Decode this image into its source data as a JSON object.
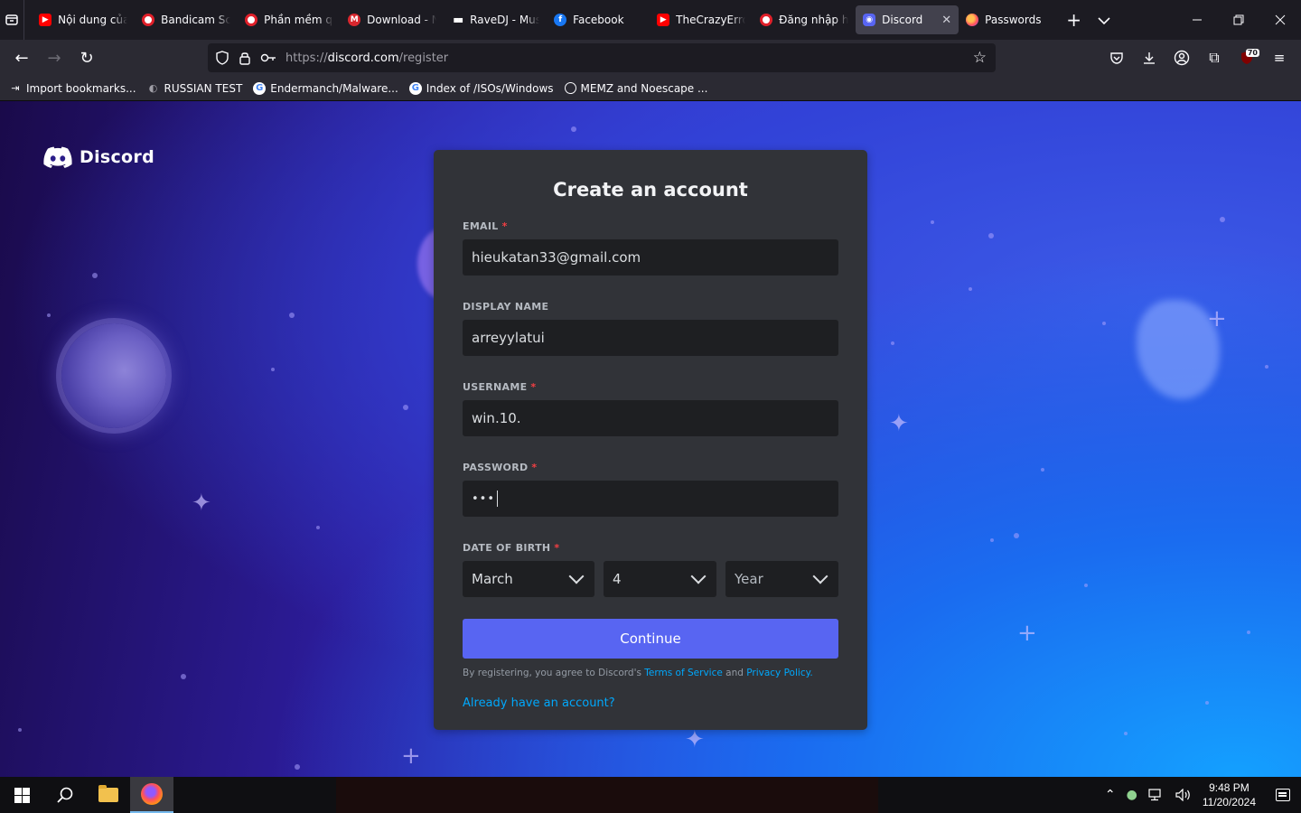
{
  "browser": {
    "tabs": [
      {
        "label": "Nội dung của",
        "favicon": "youtube-icon"
      },
      {
        "label": "Bandicam Sc",
        "favicon": "record-icon"
      },
      {
        "label": "Phần mềm q",
        "favicon": "record-icon"
      },
      {
        "label": "Download - N",
        "favicon": "mega-icon"
      },
      {
        "label": "RaveDJ - Mus",
        "favicon": "ravedj-icon"
      },
      {
        "label": "Facebook",
        "favicon": "facebook-icon"
      },
      {
        "label": "TheCrazyErro",
        "favicon": "youtube-icon"
      },
      {
        "label": "Đăng nhập h",
        "favicon": "record-icon"
      },
      {
        "label": "Discord",
        "favicon": "discord-icon",
        "active": true
      },
      {
        "label": "Passwords",
        "favicon": "firefox-icon"
      }
    ],
    "url": {
      "prefix": "https://",
      "host": "discord.com",
      "path": "/register"
    },
    "extensions_badge": "70",
    "bookmarks": [
      {
        "label": "Import bookmarks...",
        "icon": "import-icon"
      },
      {
        "label": "RUSSIAN TEST",
        "icon": "russian-test-icon"
      },
      {
        "label": "Endermanch/Malware...",
        "icon": "google-icon"
      },
      {
        "label": "Index of /ISOs/Windows",
        "icon": "google-icon"
      },
      {
        "label": "MEMZ and Noescape ...",
        "icon": "globe-icon"
      }
    ]
  },
  "page": {
    "brand": "Discord",
    "title": "Create an account",
    "fields": {
      "email": {
        "label": "EMAIL",
        "required": "*",
        "value": "hieukatan33@gmail.com"
      },
      "display_name": {
        "label": "DISPLAY NAME",
        "value": "arreyylatui"
      },
      "username": {
        "label": "USERNAME",
        "required": "*",
        "value": "win.10."
      },
      "password": {
        "label": "PASSWORD",
        "required": "*",
        "value": "•••"
      },
      "dob": {
        "label": "DATE OF BIRTH",
        "required": "*",
        "month": "March",
        "day": "4",
        "year_placeholder": "Year"
      }
    },
    "continue_label": "Continue",
    "legal": {
      "prefix": "By registering, you agree to Discord's ",
      "tos": "Terms of Service",
      "and": " and ",
      "privacy": "Privacy Policy",
      "suffix": "."
    },
    "login_link": "Already have an account?"
  },
  "taskbar": {
    "time": "9:48 PM",
    "date": "11/20/2024"
  },
  "colors": {
    "accent": "#5865f2",
    "link": "#00a8fc",
    "required": "#f23f43",
    "card": "#313338",
    "input": "#1e1f22"
  }
}
